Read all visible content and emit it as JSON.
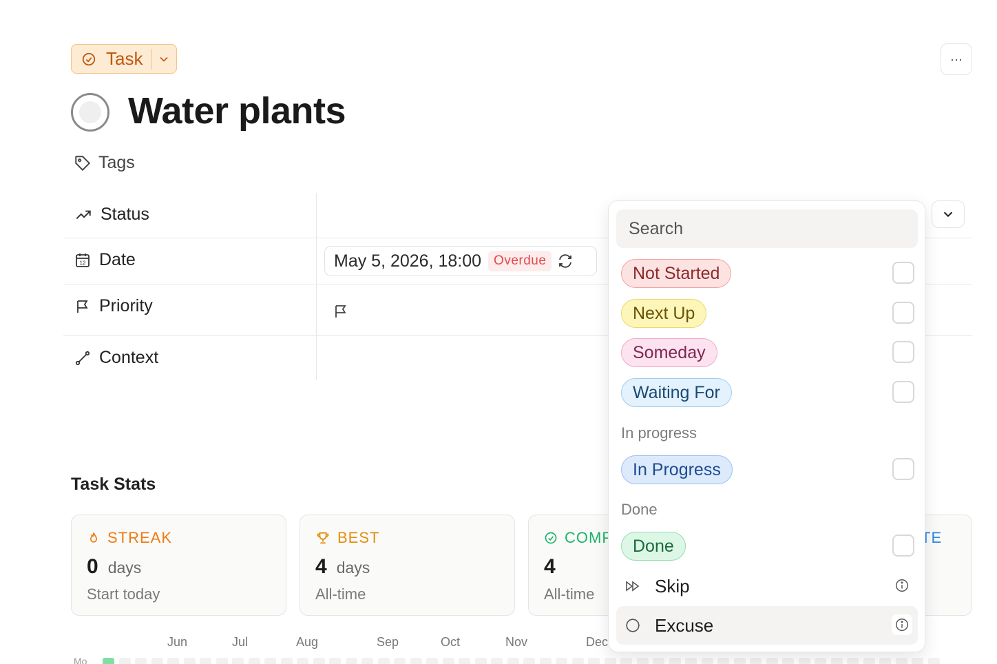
{
  "header": {
    "type_label": "Task",
    "more_label": "···",
    "title": "Water plants",
    "tags_label": "Tags"
  },
  "properties": {
    "status_label": "Status",
    "date_label": "Date",
    "priority_label": "Priority",
    "context_label": "Context",
    "date_value": "May 5, 2026, 18:00",
    "date_badge": "Overdue"
  },
  "stats": {
    "title": "Task Stats",
    "cards": [
      {
        "label": "STREAK",
        "value": "0",
        "unit": "days",
        "sub": "Start today",
        "color": "#f07b12"
      },
      {
        "label": "BEST",
        "value": "4",
        "unit": "days",
        "sub": "All-time",
        "color": "#e38f0d"
      },
      {
        "label": "COMP",
        "value": "4",
        "unit": "",
        "sub": "All-time",
        "color": "#1fb36a"
      },
      {
        "label": "TE",
        "value": "",
        "unit": "",
        "sub": "",
        "color": "#2f86e8"
      }
    ],
    "months": [
      "Jun",
      "Jul",
      "Aug",
      "Sep",
      "Oct",
      "Nov",
      "Dec"
    ],
    "heatmap_row_label": "Mo"
  },
  "dropdown": {
    "search_placeholder": "Search",
    "options": [
      {
        "label": "Not Started",
        "bg": "#fde2e2",
        "border": "#f5a3a3",
        "color": "#8c2a2a"
      },
      {
        "label": "Next Up",
        "bg": "#fdf6b8",
        "border": "#ecd96a",
        "color": "#6a5308"
      },
      {
        "label": "Someday",
        "bg": "#fde2ef",
        "border": "#f2a9cc",
        "color": "#7d2851"
      },
      {
        "label": "Waiting For",
        "bg": "#e3f2fd",
        "border": "#9fcdf0",
        "color": "#184a72"
      }
    ],
    "group_in_progress": "In progress",
    "in_progress_option": {
      "label": "In Progress",
      "bg": "#dceafc",
      "border": "#9cc1f2",
      "color": "#1f4d8f"
    },
    "group_done": "Done",
    "done_option": {
      "label": "Done",
      "bg": "#ddf7e6",
      "border": "#95dcb0",
      "color": "#1e6a3d"
    },
    "skip_label": "Skip",
    "excuse_label": "Excuse"
  }
}
